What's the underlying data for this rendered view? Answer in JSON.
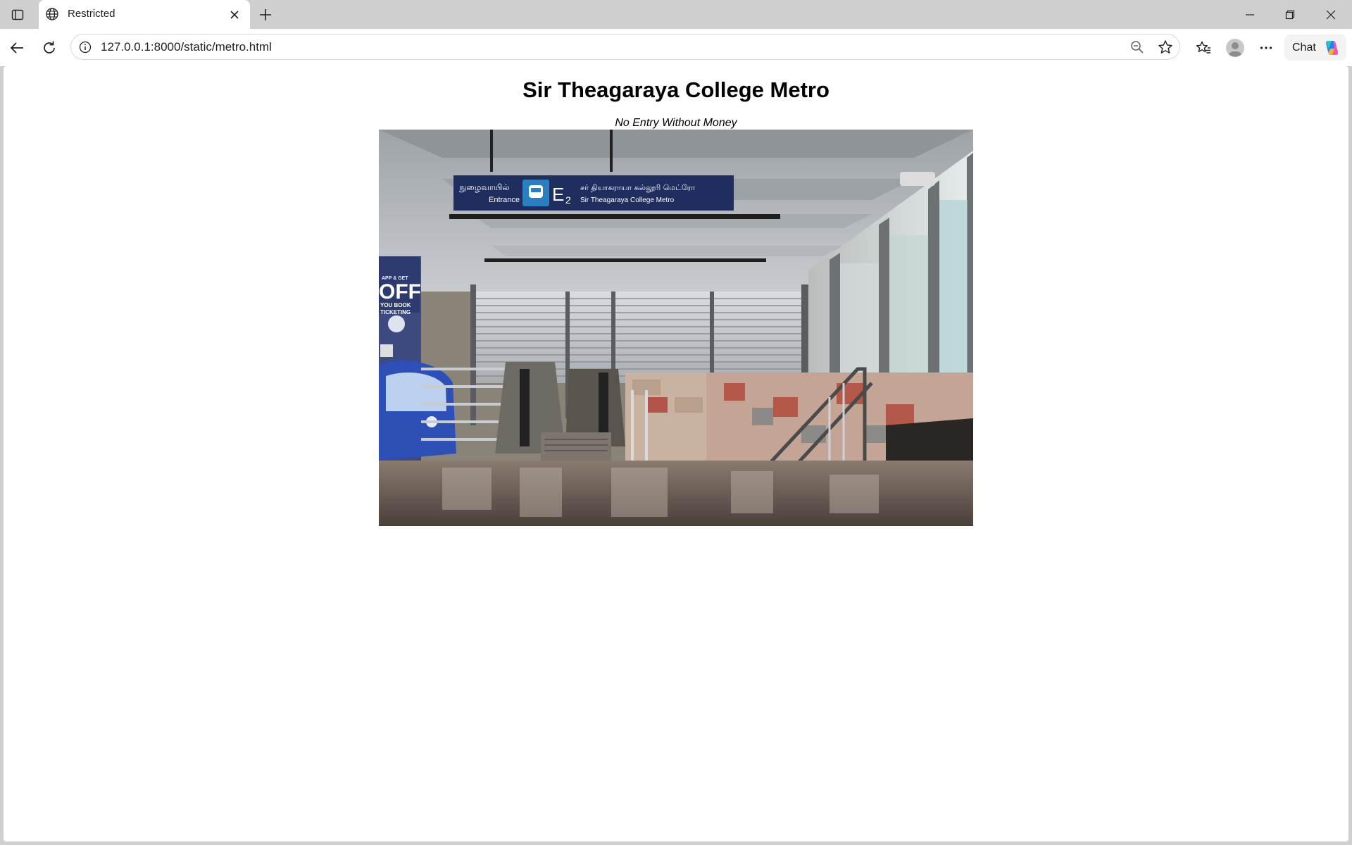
{
  "browser": {
    "tab": {
      "title": "Restricted"
    },
    "address_bar": {
      "url": "127.0.0.1:8000/static/metro.html"
    },
    "chat_button": {
      "label": "Chat"
    }
  },
  "page": {
    "heading": "Sir Theagaraya College Metro",
    "caption": "No Entry Without Money",
    "photo": {
      "sign": {
        "tamil_entrance": "நுழைவாயில்",
        "entrance": "Entrance",
        "gate": "E",
        "gate_number": "2",
        "tamil_station": "சர் தியாகராயா கல்லூரி மெட்ரோ",
        "station": "Sir Theagaraya College Metro"
      },
      "poster": {
        "line1": "APP & GET",
        "line2": "OFF",
        "line3": "YOU BOOK",
        "line4": "TICKETING"
      }
    }
  },
  "icons": {
    "tab_actions": "tab-actions-icon",
    "favicon": "globe-icon",
    "tab_close": "close-icon",
    "new_tab": "plus-icon",
    "minimize": "minimize-icon",
    "maximize": "restore-icon",
    "close": "close-window-icon",
    "back": "back-arrow-icon",
    "reload": "reload-icon",
    "site_info": "info-icon",
    "zoom": "zoom-out-icon",
    "favorite": "star-icon",
    "favorites": "favorites-icon",
    "profile": "profile-avatar-icon",
    "more": "more-icon",
    "copilot": "copilot-icon"
  }
}
